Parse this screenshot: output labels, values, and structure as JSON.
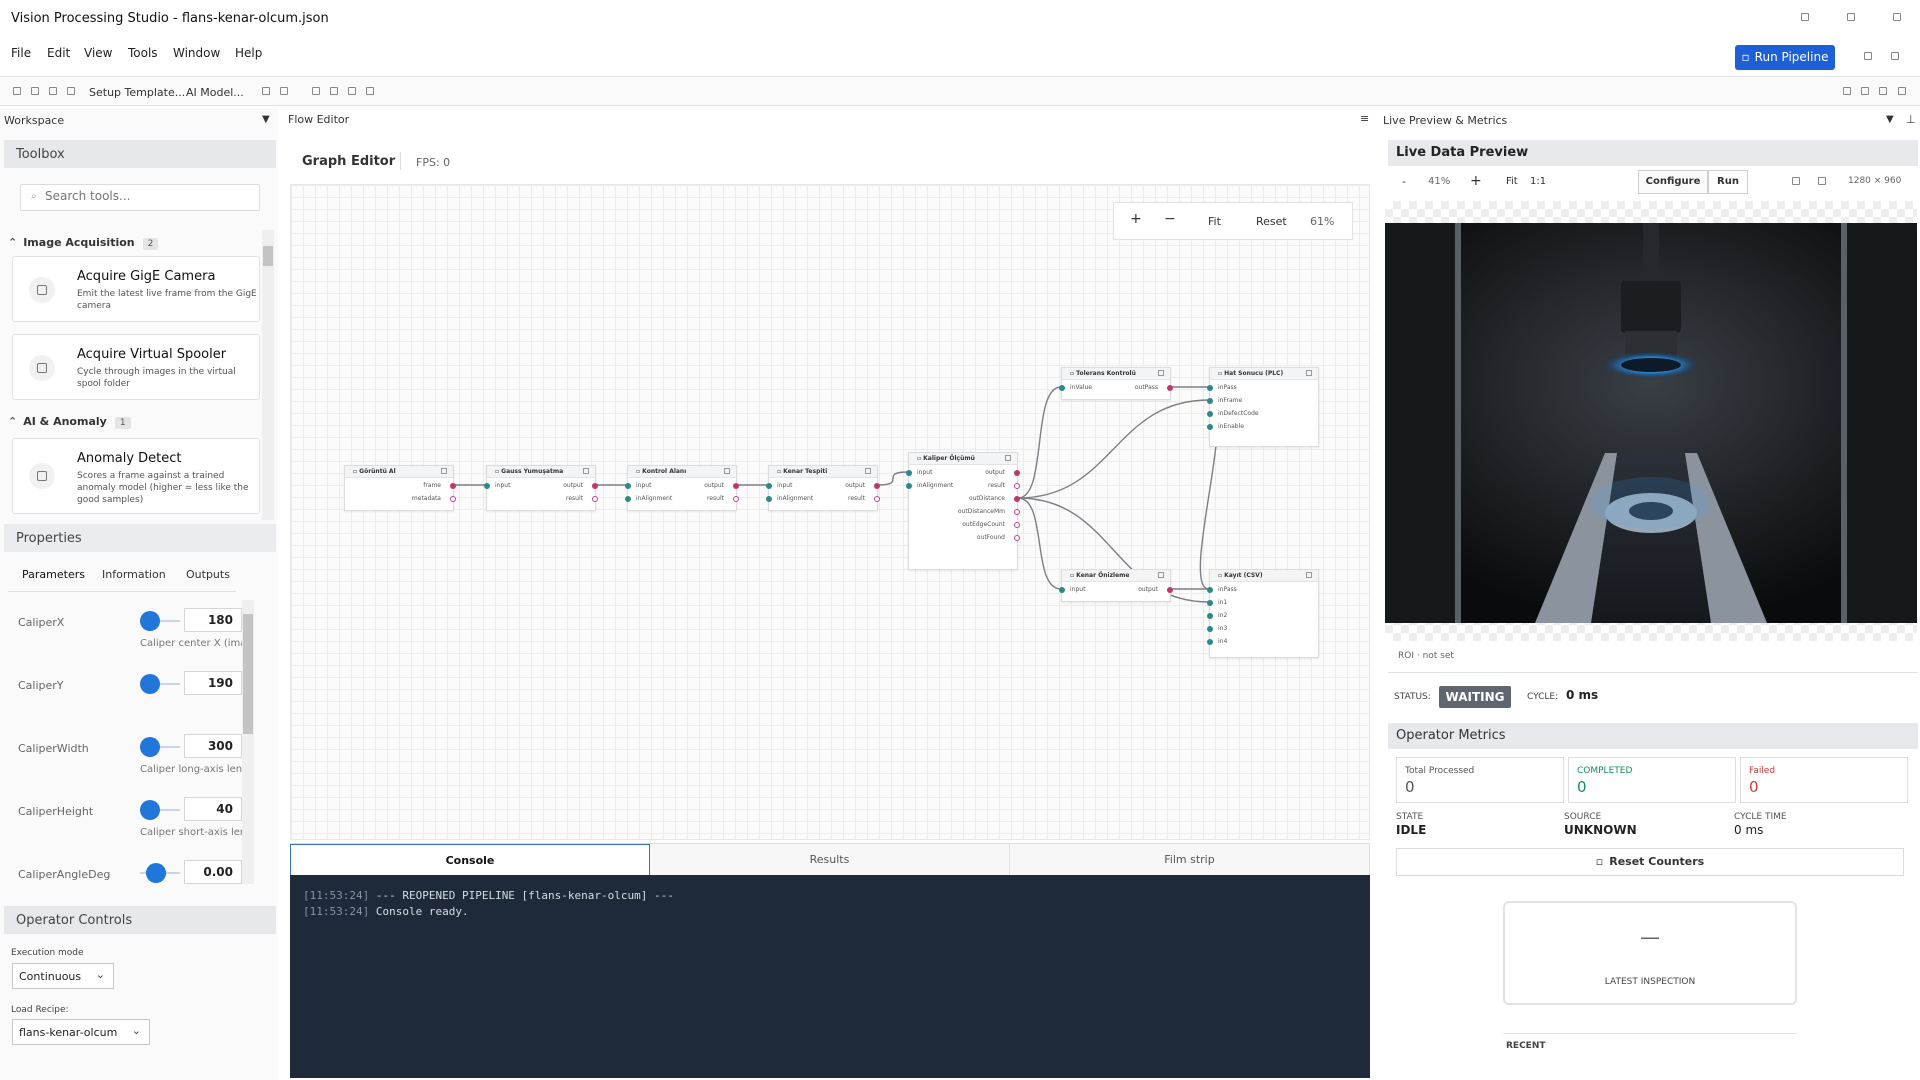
{
  "window": {
    "title": "Vision Processing Studio - flans-kenar-olcum.json"
  },
  "menu": [
    "File",
    "Edit",
    "View",
    "Tools",
    "Window",
    "Help"
  ],
  "run_pipeline": "Run Pipeline",
  "toolbar": {
    "setup_template": "Setup Template...",
    "ai_model": "AI Model..."
  },
  "workspace": {
    "label": "Workspace"
  },
  "toolbox": {
    "title": "Toolbox",
    "search_placeholder": "Search tools...",
    "sections": [
      {
        "name": "Image Acquisition",
        "count": "2"
      },
      {
        "name": "AI & Anomaly",
        "count": "1"
      }
    ],
    "tools": [
      {
        "title": "Acquire GigE Camera",
        "desc": "Emit the latest live frame from the GigE camera"
      },
      {
        "title": "Acquire Virtual Spooler",
        "desc": "Cycle through images in the virtual spool folder"
      },
      {
        "title": "Anomaly Detect",
        "desc": "Scores a frame against a trained anomaly model (higher = less like the good samples)"
      }
    ]
  },
  "properties": {
    "title": "Properties",
    "tabs": [
      "Parameters",
      "Information",
      "Outputs"
    ],
    "params": [
      {
        "name": "CaliperX",
        "value": "180",
        "hint": "Caliper center X (image"
      },
      {
        "name": "CaliperY",
        "value": "190",
        "hint": ""
      },
      {
        "name": "CaliperWidth",
        "value": "300",
        "hint": "Caliper long-axis lengt"
      },
      {
        "name": "CaliperHeight",
        "value": "40",
        "hint": "Caliper short-axis lengt"
      },
      {
        "name": "CaliperAngleDeg",
        "value": "0.00",
        "hint": ""
      }
    ]
  },
  "operator_controls": {
    "title": "Operator Controls",
    "exec_label": "Execution mode",
    "exec_value": "Continuous",
    "recipe_label": "Load Recipe:",
    "recipe_value": "flans-kenar-olcum"
  },
  "flow": {
    "panel_label": "Flow Editor",
    "graph_title": "Graph Editor",
    "fps": "FPS: 0",
    "zoom": {
      "plus": "+",
      "minus": "−",
      "fit": "Fit",
      "reset": "Reset",
      "pct": "61%"
    },
    "nodes": [
      {
        "id": "n1",
        "title": "Görüntü Al",
        "inputs": [],
        "outputs": [
          "frame",
          "metadata"
        ]
      },
      {
        "id": "n2",
        "title": "Gauss Yumuşatma",
        "inputs": [
          "input"
        ],
        "outputs": [
          "output",
          "result"
        ]
      },
      {
        "id": "n3",
        "title": "Kontrol Alanı",
        "inputs": [
          "input",
          "inAlignment"
        ],
        "outputs": [
          "output",
          "result"
        ]
      },
      {
        "id": "n4",
        "title": "Kenar Tespiti",
        "inputs": [
          "input",
          "inAlignment"
        ],
        "outputs": [
          "output",
          "result"
        ]
      },
      {
        "id": "n5",
        "title": "Kaliper Ölçümü",
        "inputs": [
          "input",
          "inAlignment"
        ],
        "outputs": [
          "output",
          "result",
          "outDistance",
          "outDistanceMm",
          "outEdgeCount",
          "outFound"
        ]
      },
      {
        "id": "n6",
        "title": "Tolerans Kontrolü",
        "inputs": [
          "inValue"
        ],
        "outputs": [
          "outPass"
        ]
      },
      {
        "id": "n7",
        "title": "Hat Sonucu (PLC)",
        "inputs": [
          "inPass",
          "inFrame",
          "inDefectCode",
          "inEnable"
        ],
        "outputs": []
      },
      {
        "id": "n8",
        "title": "Kenar Önizleme",
        "inputs": [
          "input"
        ],
        "outputs": [
          "output"
        ]
      },
      {
        "id": "n9",
        "title": "Kayıt (CSV)",
        "inputs": [
          "inPass",
          "in1",
          "in2",
          "in3",
          "in4"
        ],
        "outputs": []
      }
    ]
  },
  "bottom_tabs": [
    "Console",
    "Results",
    "Film strip"
  ],
  "console": [
    {
      "ts": "[11:53:24]",
      "msg": "--- REOPENED PIPELINE [flans-kenar-olcum] ---"
    },
    {
      "ts": "[11:53:24]",
      "msg": "Console ready."
    }
  ],
  "right": {
    "panel_label": "Live Preview & Metrics",
    "preview_title": "Live Data Preview",
    "zoom_minus": "-",
    "zoom_pct": "41%",
    "zoom_plus": "+",
    "fit": "Fit",
    "one_to_one": "1:1",
    "configure": "Configure",
    "run": "Run",
    "resolution": "1280 × 960",
    "roi": "ROI · not set",
    "status_label": "STATUS:",
    "status_value": "WAITING",
    "cycle_label": "CYCLE:",
    "cycle_value": "0 ms",
    "metrics_title": "Operator Metrics",
    "metrics": [
      {
        "label": "Total Processed",
        "value": "0",
        "color": "#555555"
      },
      {
        "label": "COMPLETED",
        "value": "0",
        "color": "#178f5a"
      },
      {
        "label": "Failed",
        "value": "0",
        "color": "#d23a3a"
      }
    ],
    "state": [
      {
        "k": "STATE",
        "v": "IDLE"
      },
      {
        "k": "SOURCE",
        "v": "UNKNOWN"
      },
      {
        "k": "CYCLE TIME",
        "v": "0 ms"
      }
    ],
    "reset_counters": "Reset Counters",
    "latest_dash": "—",
    "latest_inspection": "LATEST INSPECTION",
    "recent": "RECENT"
  }
}
